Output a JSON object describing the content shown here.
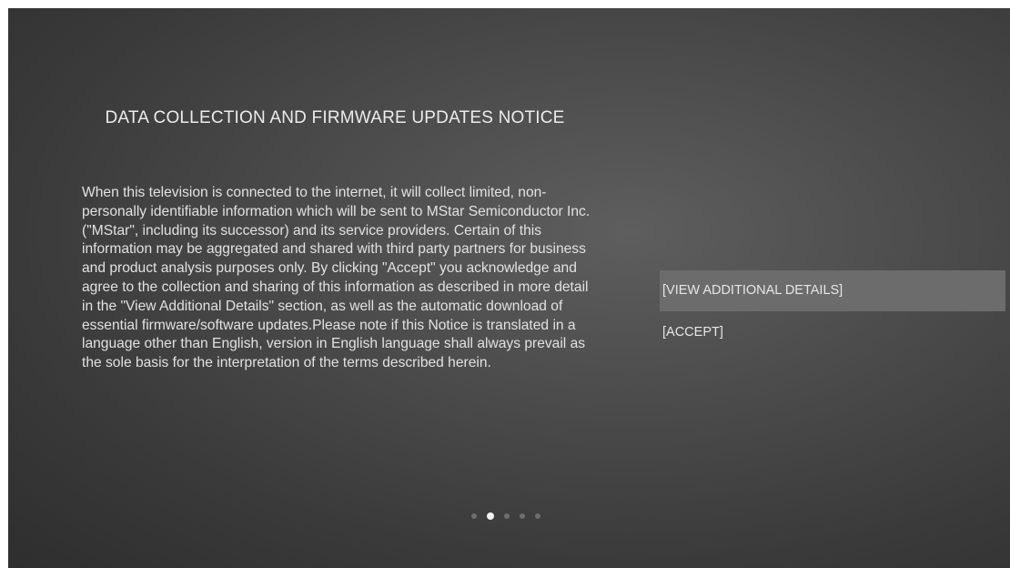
{
  "notice": {
    "title": "DATA COLLECTION AND FIRMWARE UPDATES NOTICE",
    "body": "When this television is connected to the internet, it will collect limited, non-personally identifiable information which will be sent to MStar Semiconductor Inc. (\"MStar\", including its successor) and its service providers. Certain of this information may be aggregated and shared with third party partners for business and product analysis purposes only. By clicking \"Accept\" you acknowledge and agree to the collection and sharing of this information as described in more detail in the \"View Additional Details\" section, as well as the automatic download of essential firmware/software updates.Please note if this Notice is translated in a language other than English, version in English language shall always prevail as the sole basis for the interpretation of the terms described herein."
  },
  "menu": {
    "view_details_label": "[VIEW ADDITIONAL DETAILS]",
    "accept_label": "[ACCEPT]"
  },
  "pagination": {
    "total_pages": 5,
    "current_page": 2
  },
  "colors": {
    "focus_highlight": "#6c6c6c",
    "active_dot": "#f2f2f2",
    "inactive_dot": "#6e6e6e"
  }
}
